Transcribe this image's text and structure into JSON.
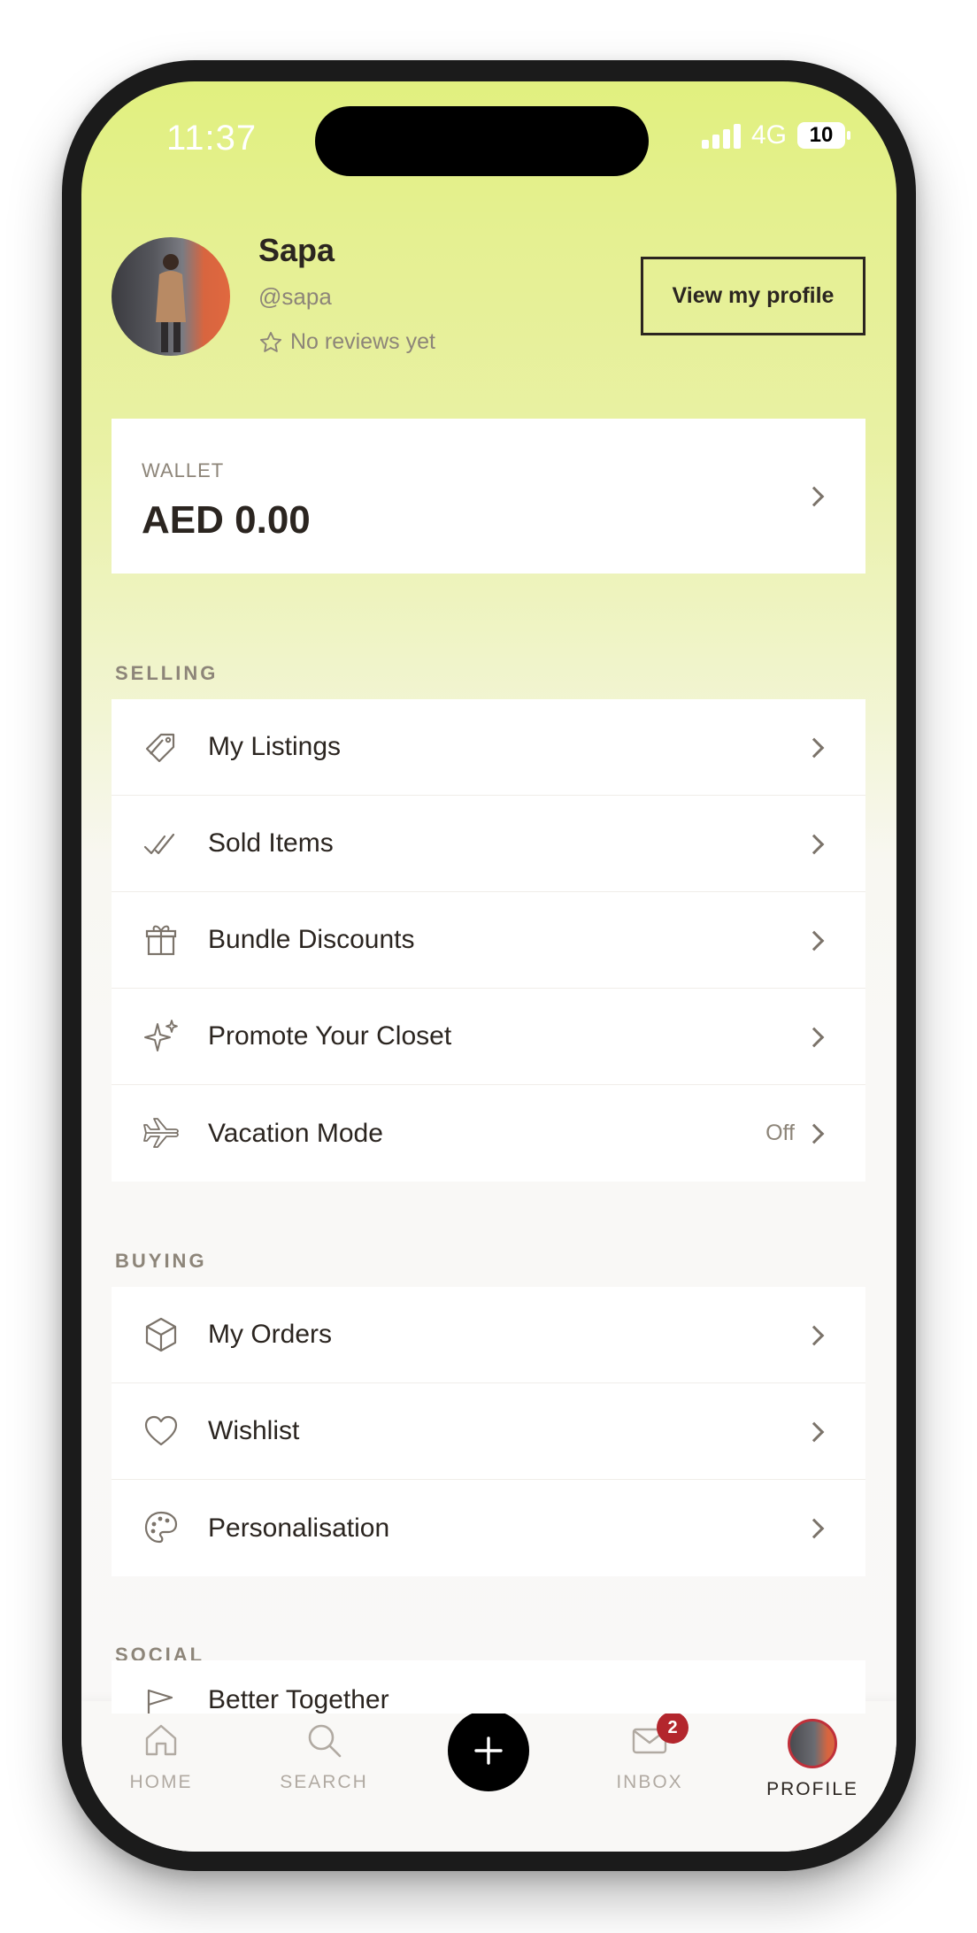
{
  "status_bar": {
    "time": "11:37",
    "network": "4G",
    "battery": "10"
  },
  "profile": {
    "name": "Sapa",
    "handle": "@sapa",
    "reviews": "No reviews yet",
    "view_button": "View my profile"
  },
  "wallet": {
    "label": "WALLET",
    "amount": "AED 0.00"
  },
  "sections": {
    "selling": {
      "title": "SELLING",
      "items": [
        {
          "label": "My Listings",
          "icon": "tag-icon"
        },
        {
          "label": "Sold Items",
          "icon": "double-check-icon"
        },
        {
          "label": "Bundle Discounts",
          "icon": "gift-icon"
        },
        {
          "label": "Promote Your Closet",
          "icon": "sparkle-icon"
        },
        {
          "label": "Vacation Mode",
          "icon": "airplane-icon",
          "value": "Off"
        }
      ]
    },
    "buying": {
      "title": "BUYING",
      "items": [
        {
          "label": "My Orders",
          "icon": "box-icon"
        },
        {
          "label": "Wishlist",
          "icon": "heart-icon"
        },
        {
          "label": "Personalisation",
          "icon": "palette-icon"
        }
      ]
    },
    "social": {
      "title": "SOCIAL",
      "items": [
        {
          "label": "Better Together",
          "icon": "flag-icon"
        }
      ]
    }
  },
  "tab_bar": {
    "home": "HOME",
    "search": "SEARCH",
    "inbox": "INBOX",
    "inbox_badge": "2",
    "profile": "PROFILE"
  },
  "colors": {
    "accent_gradient_top": "#e1f07f",
    "text_primary": "#2b2520",
    "text_secondary": "#8d8579",
    "badge": "#b3262d"
  }
}
